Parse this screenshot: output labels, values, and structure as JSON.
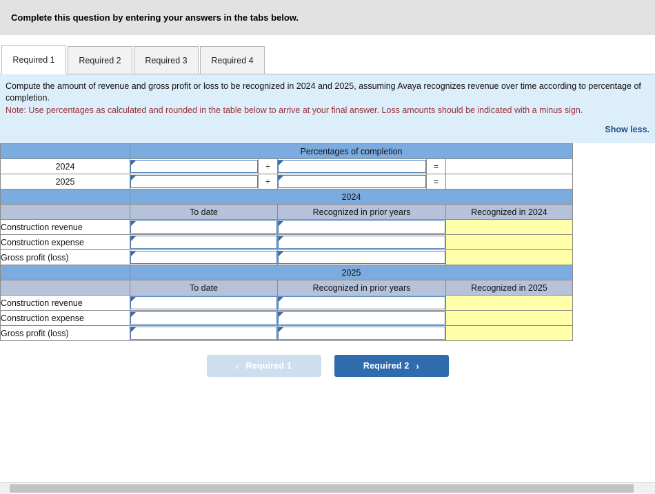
{
  "banner": {
    "title": "Complete this question by entering your answers in the tabs below."
  },
  "tabs": [
    {
      "label": "Required 1",
      "active": true
    },
    {
      "label": "Required 2",
      "active": false
    },
    {
      "label": "Required 3",
      "active": false
    },
    {
      "label": "Required 4",
      "active": false
    }
  ],
  "instructions": {
    "main": "Compute the amount of revenue and gross profit or loss to be recognized in 2024 and 2025, assuming Avaya recognizes revenue over time according to percentage of completion.",
    "note": "Note: Use percentages as calculated and rounded in the table below to arrive at your final answer. Loss amounts should be indicated with a minus sign.",
    "show_less": "Show less."
  },
  "table": {
    "percentages_header": "Percentages of completion",
    "divide_symbol": "÷",
    "equals_symbol": "=",
    "percentage_rows": [
      {
        "year": "2024",
        "numerator": "",
        "denominator": "",
        "result": ""
      },
      {
        "year": "2025",
        "numerator": "",
        "denominator": "",
        "result": ""
      }
    ],
    "sections": [
      {
        "year": "2024",
        "columns": [
          "To date",
          "Recognized in prior years",
          "Recognized in 2024"
        ],
        "rows": [
          {
            "label": "Construction revenue",
            "to_date": "",
            "prior_years": "",
            "recognized": ""
          },
          {
            "label": "Construction expense",
            "to_date": "",
            "prior_years": "",
            "recognized": ""
          },
          {
            "label": "Gross profit (loss)",
            "to_date": "",
            "prior_years": "",
            "recognized": ""
          }
        ]
      },
      {
        "year": "2025",
        "columns": [
          "To date",
          "Recognized in prior years",
          "Recognized in 2025"
        ],
        "rows": [
          {
            "label": "Construction revenue",
            "to_date": "",
            "prior_years": "",
            "recognized": ""
          },
          {
            "label": "Construction expense",
            "to_date": "",
            "prior_years": "",
            "recognized": ""
          },
          {
            "label": "Gross profit (loss)",
            "to_date": "",
            "prior_years": "",
            "recognized": ""
          }
        ]
      }
    ]
  },
  "navigation": {
    "prev_label": "Required 1",
    "next_label": "Required 2",
    "prev_chevron": "‹",
    "next_chevron": "›"
  },
  "colors": {
    "section_header_blue": "#7cabe0",
    "column_header_gray": "#b6c2da",
    "readonly_yellow": "#ffffaa",
    "input_border_blue": "#4a7ebb",
    "note_red": "#99303a",
    "link_blue": "#1f4e87",
    "next_button_blue": "#2f6cad",
    "prev_button_blue": "#cfdeef",
    "instruction_panel_bg": "#ddeefb",
    "banner_bg": "#e2e2e2"
  }
}
